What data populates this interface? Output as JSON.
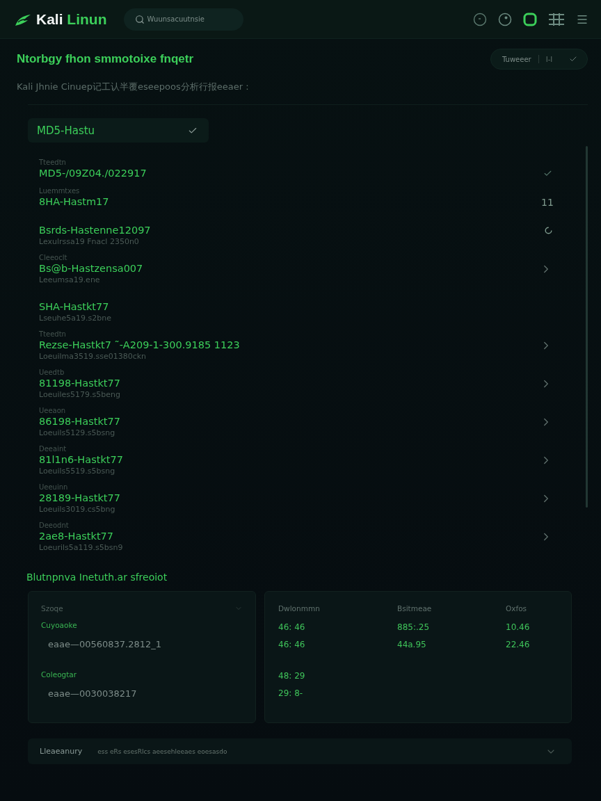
{
  "header": {
    "brand": {
      "first": "Kali",
      "second": "Linun"
    },
    "search": {
      "placeholder": "Wuunsacuutnsie"
    }
  },
  "page": {
    "title": "Ntorbgy fhon smmotoixe fnqetr",
    "action_button": {
      "label": "Tuweeer",
      "value": "I-I"
    },
    "subtitle": "Kali Jhnie Cinuep记工认半覆eseepoos分析行报eeaer :"
  },
  "hash_panel": {
    "dropdown": {
      "value": "MD5-Hastu"
    },
    "items": [
      {
        "caption": "Tteedtn",
        "main": "MD5-/09Z04./022917",
        "trail": {
          "kind": "check"
        }
      },
      {
        "caption": "Luemmtxes",
        "main": "8HA-Hastm17",
        "trail": {
          "kind": "count",
          "text": "11"
        }
      },
      {
        "main": "Bsrds-Hastenne12097",
        "sub": "Lexulrssa19 Fnacl 2350n0",
        "trail": {
          "kind": "ring"
        }
      },
      {
        "caption": "Cleeoclt",
        "main": "Bs@b-Hastzensa007",
        "sub": "Leeumsa19.ene",
        "trail": {
          "kind": "chevron"
        }
      },
      {
        "main": "SHA-Hastkt77",
        "sub": "Lseuhe5a19.s2bne"
      },
      {
        "caption": "Tteedtn",
        "main": "Rezse-Hastkt7 ˜-A209-1-300.9185 1123",
        "sub": "Loeuilma3519.sse01380ckn",
        "trail": {
          "kind": "chevron"
        }
      },
      {
        "caption": "Ueedtb",
        "main": "81198-Hastkt77",
        "sub": "Loeuiles5179.s5beng",
        "trail": {
          "kind": "chevron"
        }
      },
      {
        "caption": "Ueeaon",
        "main": "86198-Hastkt77",
        "sub": "Loeuils5129.s5bsng",
        "trail": {
          "kind": "chevron"
        }
      },
      {
        "caption": "Deeaint",
        "main": "81l1n6-Hastkt77",
        "sub": "Loeuils5519.s5bsng",
        "trail": {
          "kind": "chevron"
        }
      },
      {
        "caption": "Ueeuinn",
        "main": "28189-Hastkt77",
        "sub": "Loeuils3019.cs5bng",
        "trail": {
          "kind": "chevron"
        }
      },
      {
        "caption": "Deeodnt",
        "main": "2ae8-Hastkt77",
        "sub": "Loeurils5a119.s5bsn9",
        "trail": {
          "kind": "chevron"
        }
      }
    ]
  },
  "details": {
    "title": "Blutnpnva Inetuth.ar sfreoiot",
    "left_card": {
      "label": "Szoqe",
      "entries": [
        {
          "name": "Cuyoaoke",
          "value": "eaae—00560837.2812_1"
        },
        {
          "name": "Coleogtar",
          "value": "eaae—0030038217"
        }
      ]
    },
    "table": {
      "columns": [
        "Dwlonmmn",
        "Bsitmeae",
        "Oxfos"
      ],
      "rows": [
        [
          "46: 46",
          "885:.25",
          "10.46"
        ],
        [
          "46: 46",
          "44a.95",
          "22.46"
        ],
        [
          "48: 29"
        ],
        [
          "29: 8-"
        ]
      ]
    }
  },
  "footer_bar": {
    "label": "Lleaeanury",
    "text": "ess eRs esesRlcs aeesehleeaes eoesasdo"
  }
}
